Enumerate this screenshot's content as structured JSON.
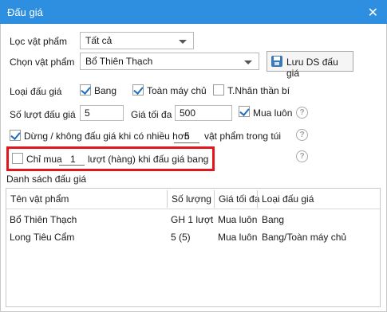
{
  "window": {
    "title": "Đấu giá",
    "close_glyph": "✕"
  },
  "filter": {
    "label": "Lọc vật phẩm",
    "value": "Tất cả"
  },
  "item_select": {
    "label": "Chọn vật phẩm",
    "value": "Bổ Thiên Thạch"
  },
  "save_button": {
    "label": "Lưu DS đấu giá"
  },
  "auction_type": {
    "label": "Loại đấu giá",
    "options": [
      {
        "label": "Bang",
        "checked": true
      },
      {
        "label": "Toàn máy chủ",
        "checked": true
      },
      {
        "label": "T.Nhân thần bí",
        "checked": false
      }
    ]
  },
  "bid_count": {
    "label": "Số lượt đấu giá",
    "value": "5"
  },
  "max_price": {
    "label": "Giá tối đa",
    "value": "500"
  },
  "buy_now": {
    "label": "Mua luôn",
    "checked": true
  },
  "stop_rule": {
    "label_before": "Dừng / không đấu giá khi có nhiều hơn",
    "value": "5",
    "label_after": "vật phẩm trong túi",
    "checked": true
  },
  "buy_rule": {
    "label_before": "Chỉ mua",
    "value": "1",
    "label_after": "lượt (hàng) khi đấu giá bang",
    "checked": false
  },
  "help_glyph": "?",
  "list": {
    "title": "Danh sách đấu giá",
    "columns": [
      "Tên vật phẩm",
      "Số lượng",
      "Giá tối đa",
      "Loại đấu giá"
    ],
    "rows": [
      [
        "Bổ Thiên Thạch",
        "GH 1 lượt",
        "Mua luôn",
        "Bang"
      ],
      [
        "Long Tiêu Cẩm",
        "5 (5)",
        "Mua luôn",
        "Bang/Toàn máy chủ"
      ]
    ]
  }
}
